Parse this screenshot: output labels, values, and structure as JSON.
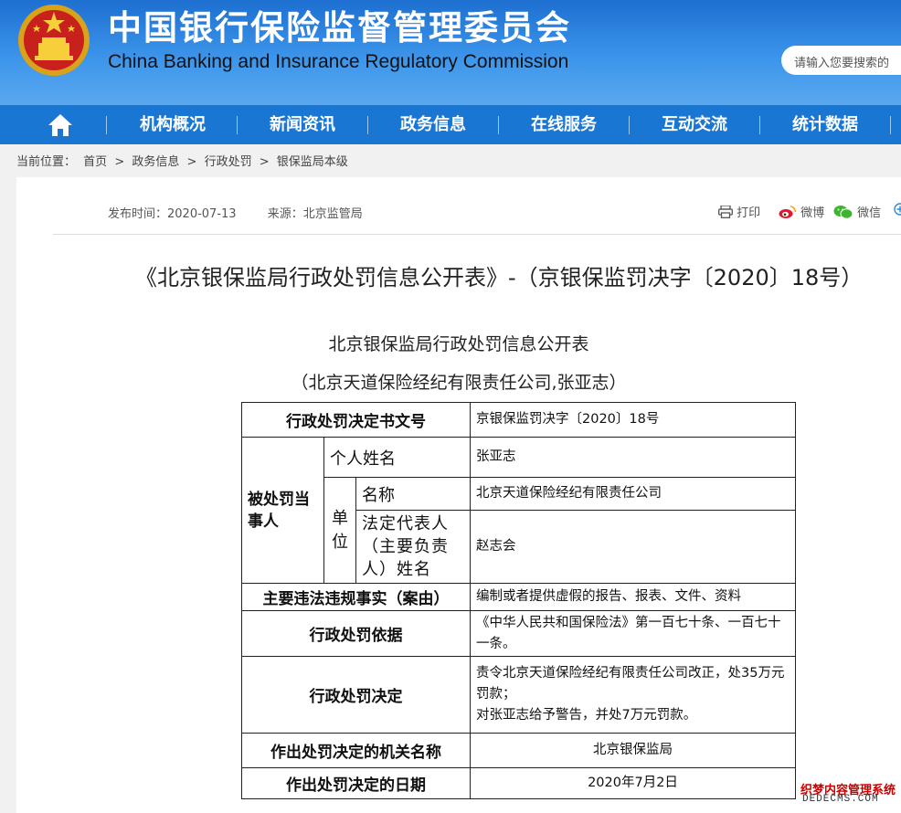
{
  "header": {
    "title_cn": "中国银行保险监督管理委员会",
    "title_en": "China Banking and Insurance Regulatory Commission",
    "search_placeholder": "请输入您要搜索的"
  },
  "nav": {
    "items": [
      {
        "label": "机构概况"
      },
      {
        "label": "新闻资讯"
      },
      {
        "label": "政务信息"
      },
      {
        "label": "在线服务"
      },
      {
        "label": "互动交流"
      },
      {
        "label": "统计数据"
      }
    ]
  },
  "breadcrumb": {
    "prefix": "当前位置：",
    "items": [
      "首页",
      "政务信息",
      "行政处罚",
      "银保监局本级"
    ],
    "separator": ">"
  },
  "article": {
    "publish_time": "发布时间：2020-07-13",
    "source": "来源：北京监管局",
    "print_label": "打印",
    "weibo_label": "微博",
    "wechat_label": "微信",
    "title": "《北京银保监局行政处罚信息公开表》-（京银保监罚决字〔2020〕18号）",
    "subtitle": "北京银保监局行政处罚信息公开表",
    "subtitle2": "（北京天道保险经纪有限责任公司,张亚志）"
  },
  "table": {
    "doc_no_label": "行政处罚决定书文号",
    "doc_no": "京银保监罚决字〔2020〕18号",
    "party_label": "被处罚当事人",
    "person_label": "个人姓名",
    "person_name": "张亚志",
    "unit_label": "单位",
    "unit_name_label": "名称",
    "unit_name": "北京天道保险经纪有限责任公司",
    "legal_rep_label": "法定代表人（主要负责人）姓名",
    "legal_rep": "赵志会",
    "violation_label": "主要违法违规事实（案由）",
    "violation": "编制或者提供虚假的报告、报表、文件、资料",
    "basis_label": "行政处罚依据",
    "basis": "《中华人民共和国保险法》第一百七十条、一百七十一条。",
    "decision_label": "行政处罚决定",
    "decision_line1": "责令北京天道保险经纪有限责任公司改正，处35万元罚款；",
    "decision_line2": "对张亚志给予警告，并处7万元罚款。",
    "authority_label": "作出处罚决定的机关名称",
    "authority": "北京银保监局",
    "date_label": "作出处罚决定的日期",
    "date": "2020年7月2日"
  },
  "watermark": {
    "line1": "织梦内容管理系统",
    "line2": "DEDECMS.COM"
  }
}
